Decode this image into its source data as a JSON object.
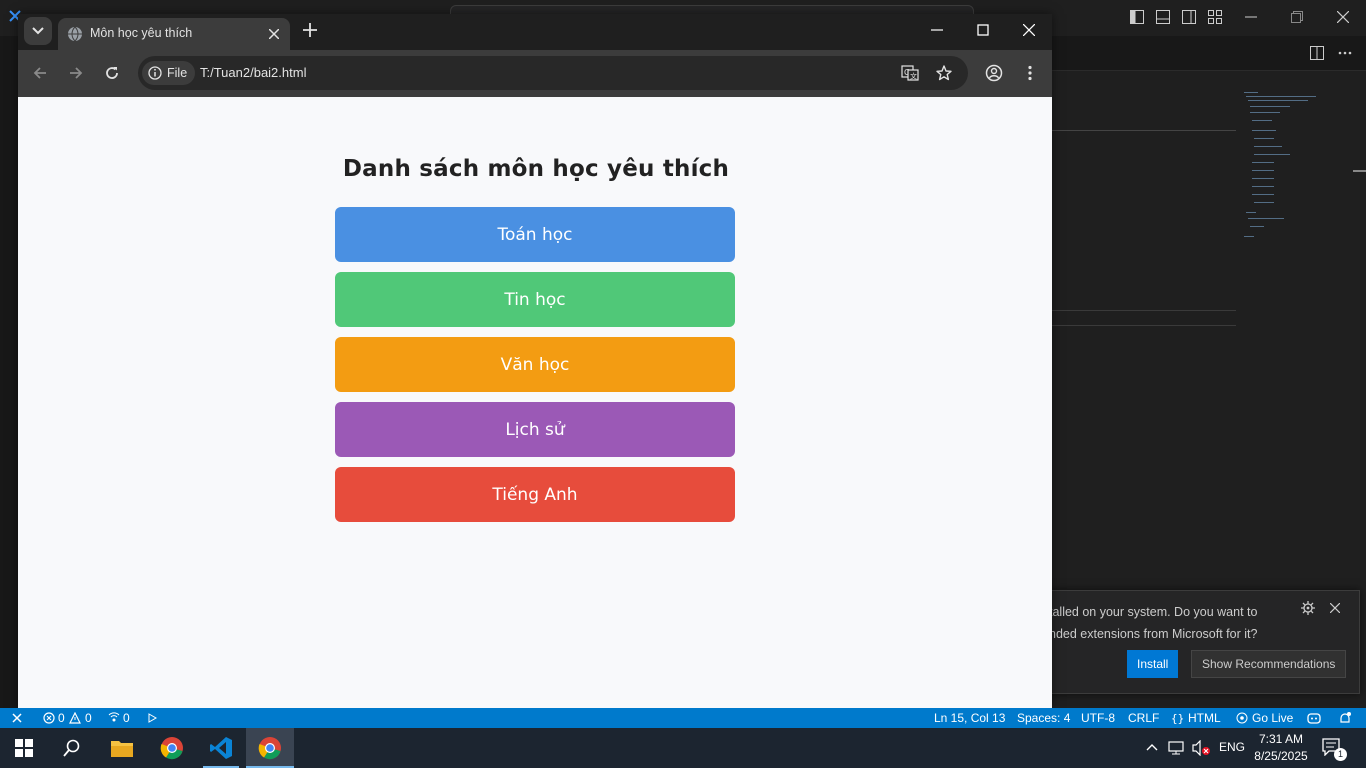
{
  "browser": {
    "tab_title": "Môn học yêu thích",
    "scheme_chip": "File",
    "url": "T:/Tuan2/bai2.html"
  },
  "page": {
    "heading": "Danh sách môn học yêu thích",
    "subjects": [
      {
        "label": "Toán học",
        "color": "#4a90e2"
      },
      {
        "label": "Tin học",
        "color": "#50c878"
      },
      {
        "label": "Văn học",
        "color": "#f39c12"
      },
      {
        "label": "Lịch sử",
        "color": "#9b59b6"
      },
      {
        "label": "Tiếng Anh",
        "color": "#e74c3c"
      }
    ]
  },
  "vscode": {
    "notification": {
      "line1": "talled on your system. Do you want to",
      "line2": "nded extensions from Microsoft for it?",
      "install_label": "Install",
      "show_recommendations_label": "Show Recommendations"
    },
    "statusbar": {
      "errors": "0",
      "warnings": "0",
      "ports": "0",
      "cursor": "Ln 15, Col 13",
      "spaces": "Spaces: 4",
      "encoding": "UTF-8",
      "eol": "CRLF",
      "language": "HTML",
      "go_live": "Go Live",
      "accent_color": "#007acc"
    }
  },
  "taskbar": {
    "language": "ENG",
    "time": "7:31 AM",
    "date": "8/25/2025",
    "notification_count": "1"
  }
}
